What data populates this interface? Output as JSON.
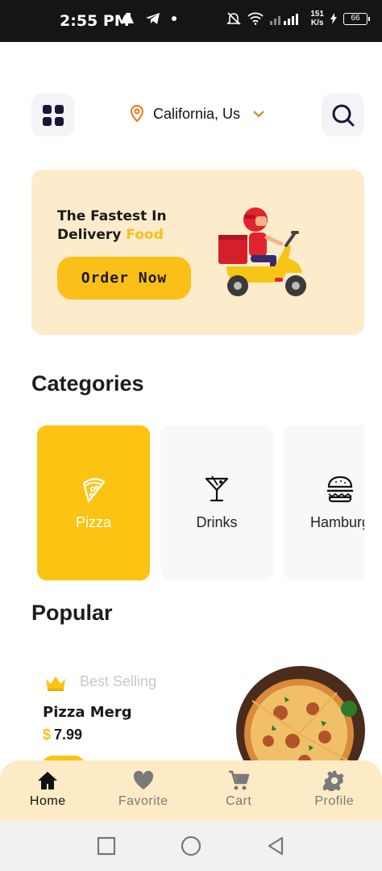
{
  "status_bar": {
    "time": "2:55 PM",
    "net_speed_value": "151",
    "net_speed_unit": "K/s",
    "battery": "66"
  },
  "header": {
    "location": "California, Us",
    "menu_icon": "grid-icon",
    "search_icon": "search-icon"
  },
  "banner": {
    "title_line1": "The Fastest In",
    "title_line2_part1": "Delivery ",
    "title_line2_highlight": "Food",
    "button_label": "Order Now",
    "illustration": "delivery-scooter-illustration"
  },
  "categories": {
    "title": "Categories",
    "items": [
      {
        "label": "Pizza",
        "icon": "pizza-icon",
        "active": true
      },
      {
        "label": "Drinks",
        "icon": "cocktail-icon",
        "active": false
      },
      {
        "label": "Hamburg",
        "icon": "burger-icon",
        "active": false
      }
    ]
  },
  "popular": {
    "title": "Popular",
    "item": {
      "badge": "Best Selling",
      "name": "Pizza Merg",
      "currency": "$",
      "price": "7.99"
    }
  },
  "bottom_nav": {
    "items": [
      {
        "label": "Home",
        "icon": "home-icon",
        "active": true
      },
      {
        "label": "Favorite",
        "icon": "heart-icon",
        "active": false
      },
      {
        "label": "Cart",
        "icon": "cart-icon",
        "active": false
      },
      {
        "label": "Profile",
        "icon": "gear-icon",
        "active": false
      }
    ]
  },
  "colors": {
    "accent": "#fbc413",
    "banner_bg": "#fdeccb",
    "nav_bg": "#fdebc6",
    "dark": "#1d1437"
  }
}
